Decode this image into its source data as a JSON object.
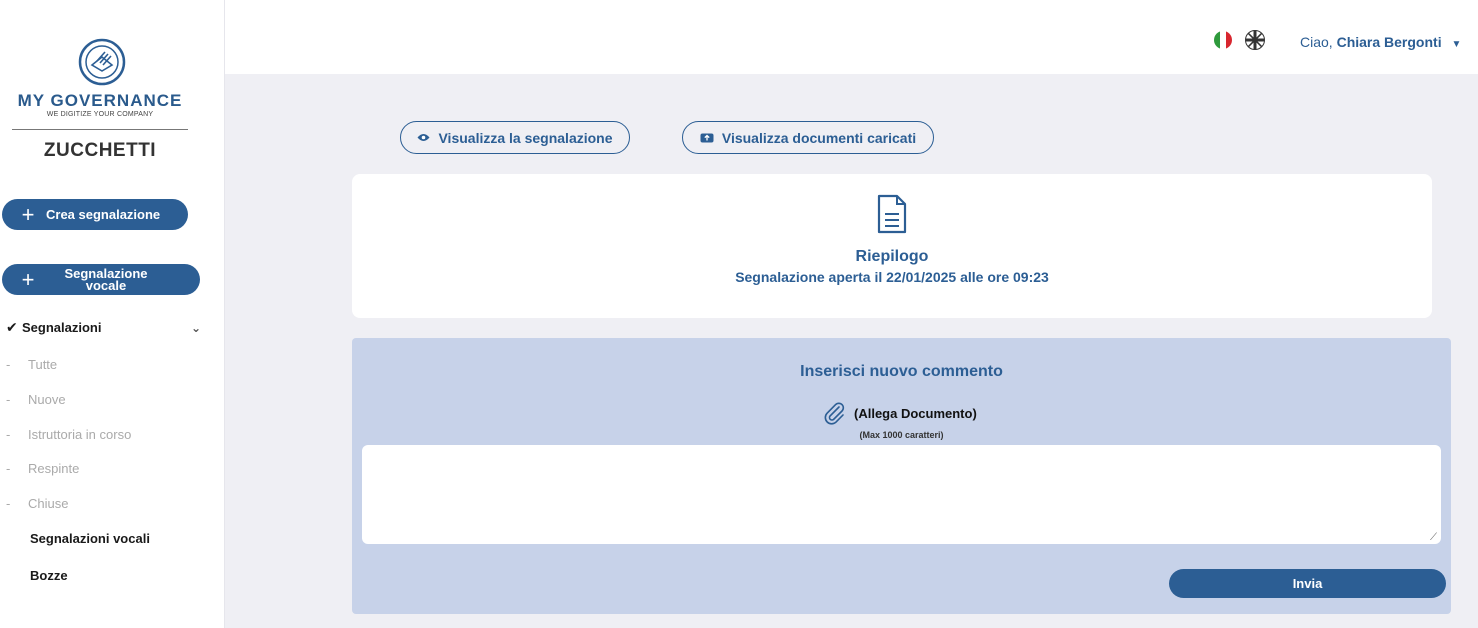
{
  "sidebar": {
    "brand": "MY GOVERNANCE",
    "tagline": "WE DIGITIZE YOUR COMPANY",
    "company": "ZUCCHETTI",
    "create_label": "Crea segnalazione",
    "voice_label": "Segnalazione vocale",
    "nav_main": "Segnalazioni",
    "sub_items": [
      "Tutte",
      "Nuove",
      "Istruttoria in corso",
      "Respinte",
      "Chiuse"
    ],
    "voice_reports": "Segnalazioni vocali",
    "drafts": "Bozze"
  },
  "header": {
    "greeting_prefix": "Ciao,",
    "user_name": "Chiara Bergonti"
  },
  "actions": {
    "view_report": "Visualizza la segnalazione",
    "view_docs": "Visualizza documenti caricati"
  },
  "summary": {
    "title": "Riepilogo",
    "subtitle": "Segnalazione aperta il 22/01/2025 alle ore 09:23"
  },
  "comment": {
    "title": "Inserisci nuovo commento",
    "attach_label": "(Allega Documento)",
    "max_label": "(Max 1000 caratteri)",
    "value": "",
    "send_label": "Invia"
  },
  "colors": {
    "accent": "#2c5e94",
    "panel": "#c7d2e9",
    "background": "#efeff4"
  }
}
